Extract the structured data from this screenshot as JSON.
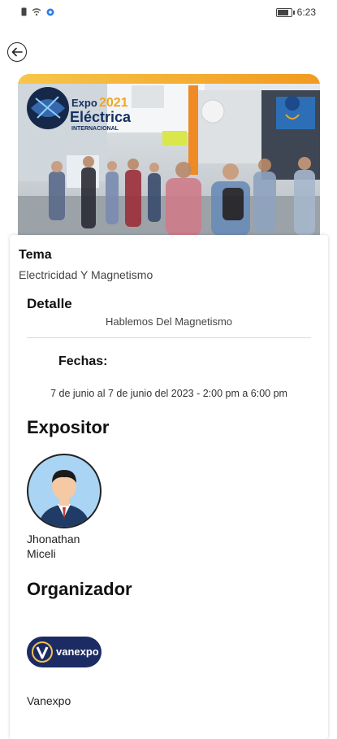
{
  "status_bar": {
    "time": "6:23",
    "battery_level": 0.8,
    "icons": [
      "sim-icon",
      "wifi-icon",
      "app-notification-icon",
      "battery-icon"
    ]
  },
  "nav": {
    "back_icon": "arrow-left-icon"
  },
  "hero": {
    "logo_line1": "Expo",
    "logo_year": "2021",
    "logo_line2": "Eléctrica",
    "logo_line3": "INTERNACIONAL"
  },
  "event": {
    "tema_label": "Tema",
    "tema_value": "Electricidad Y Magnetismo",
    "detalle_label": "Detalle",
    "detalle_value": "Hablemos Del Magnetismo",
    "fechas_label": "Fechas:",
    "fechas_value": "7 de junio al 7 de junio del 2023 - 2:00 pm a 6:00 pm"
  },
  "expositor": {
    "heading": "Expositor",
    "name": "Jhonathan Miceli"
  },
  "organizador": {
    "heading": "Organizador",
    "logo_text": "vanexpo",
    "name": "Vanexpo"
  },
  "colors": {
    "accent_orange": "#f4a92a",
    "logo_navy": "#1c2b63"
  }
}
